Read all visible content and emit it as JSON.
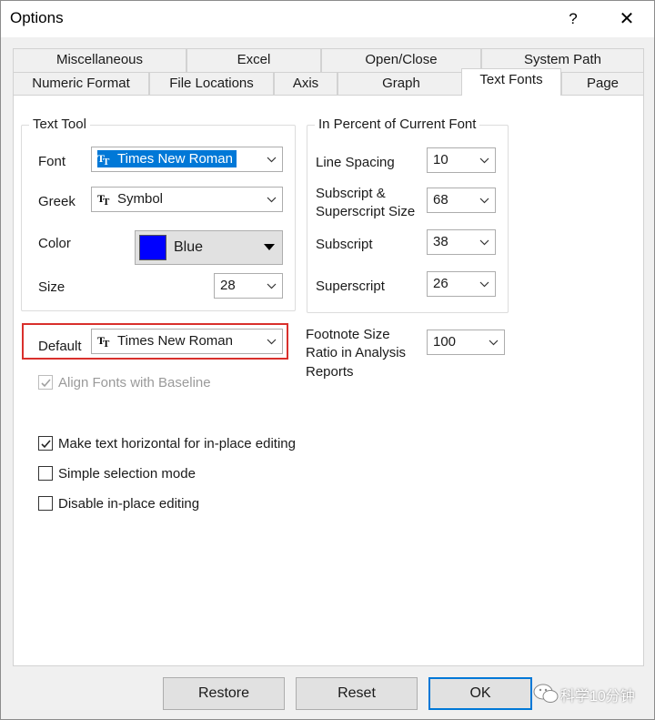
{
  "window": {
    "title": "Options",
    "help": "?",
    "close": "✕"
  },
  "tabs": {
    "row1": [
      "Miscellaneous",
      "Excel",
      "Open/Close",
      "System Path"
    ],
    "row2": [
      "Numeric Format",
      "File Locations",
      "Axis",
      "Graph",
      "Text Fonts",
      "Page"
    ],
    "active": "Text Fonts"
  },
  "text_tool": {
    "legend": "Text Tool",
    "font_label": "Font",
    "font_value": "Times New Roman",
    "greek_label": "Greek",
    "greek_value": "Symbol",
    "color_label": "Color",
    "color_value": "Blue",
    "color_hex": "#0000ff",
    "size_label": "Size",
    "size_value": "28"
  },
  "percent": {
    "legend": "In Percent of Current Font",
    "line_spacing_label": "Line Spacing",
    "line_spacing_value": "10",
    "subsup_label_1": "Subscript &",
    "subsup_label_2": "Superscript Size",
    "subsup_value": "68",
    "subscript_label": "Subscript",
    "subscript_value": "38",
    "superscript_label": "Superscript",
    "superscript_value": "26"
  },
  "default_font": {
    "label": "Default",
    "value": "Times New Roman"
  },
  "footnote": {
    "label_1": "Footnote Size",
    "label_2": "Ratio in Analysis",
    "label_3": "Reports",
    "value": "100"
  },
  "checkboxes": {
    "align": {
      "label": "Align Fonts with Baseline",
      "checked": true,
      "disabled": true
    },
    "horizontal": {
      "label": "Make text horizontal for in-place editing",
      "checked": true
    },
    "simple": {
      "label": "Simple selection mode",
      "checked": false
    },
    "disable": {
      "label": "Disable in-place editing",
      "checked": false
    }
  },
  "buttons": {
    "restore": "Restore",
    "reset": "Reset",
    "ok": "OK"
  },
  "watermark": {
    "text": "科学10分钟"
  }
}
